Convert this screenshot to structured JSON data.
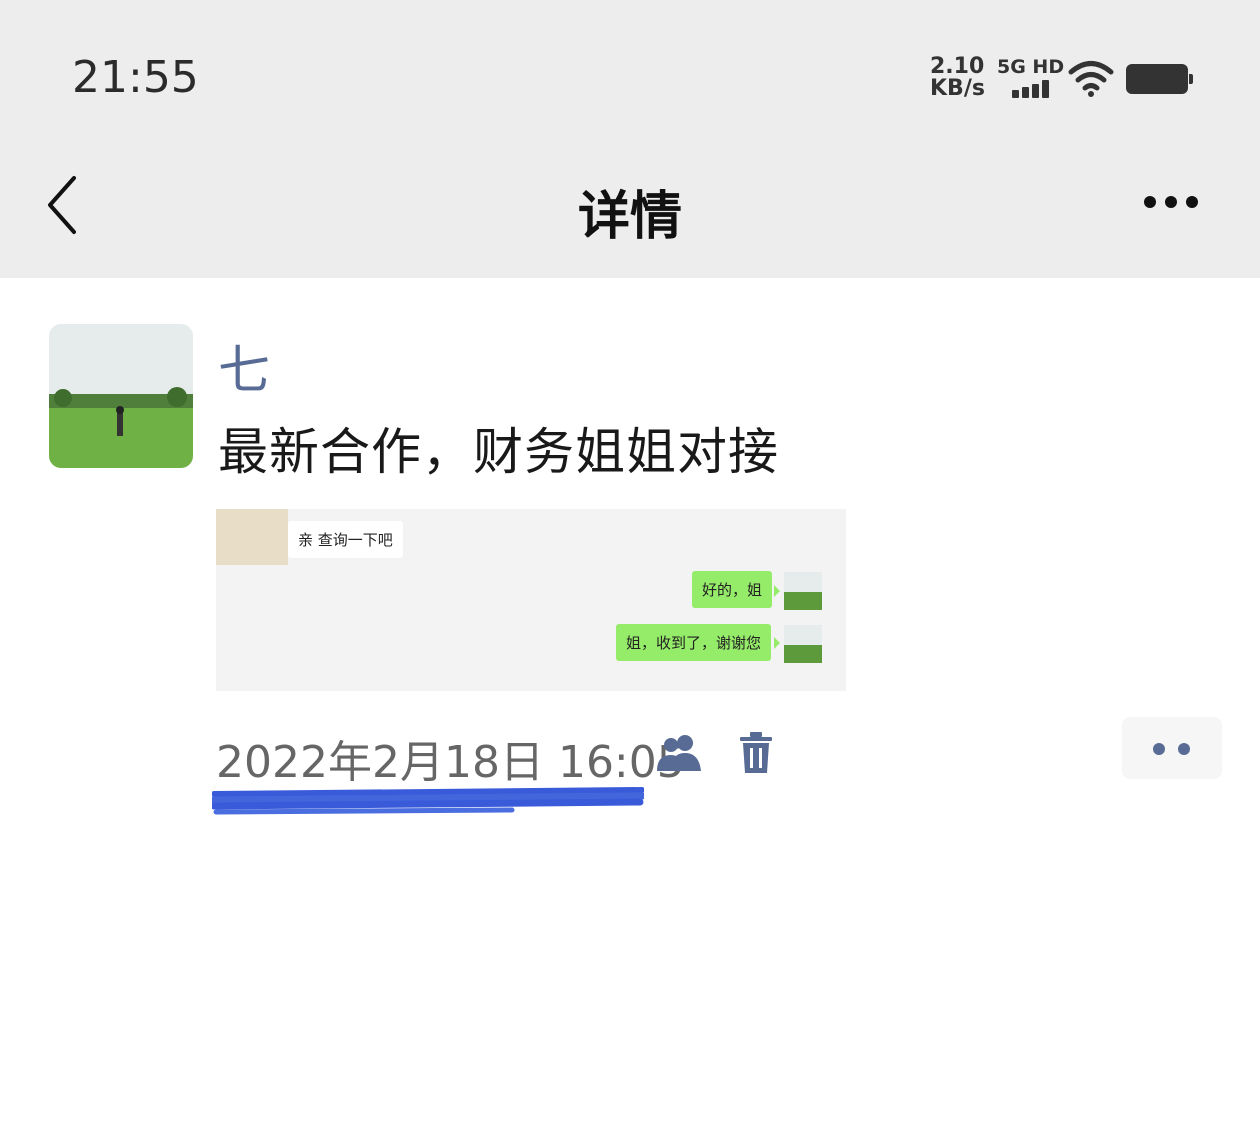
{
  "status_bar": {
    "time": "21:55",
    "net_speed_value": "2.10",
    "net_speed_unit": "KB/s",
    "network_type": "5G HD",
    "icons": [
      "signal-icon",
      "wifi-icon",
      "battery-icon"
    ]
  },
  "header": {
    "title": "详情",
    "back_icon": "chevron-left-icon",
    "more_icon": "more-icon"
  },
  "post": {
    "author": "七",
    "text": "最新合作，财务姐姐对接",
    "timestamp": "2022年2月18日 16:05",
    "icons": [
      "people-icon",
      "trash-icon",
      "comment-icon"
    ]
  },
  "screenshot": {
    "messages": [
      {
        "side": "left",
        "text": "亲 查询一下吧"
      },
      {
        "side": "right",
        "text": "好的，姐"
      },
      {
        "side": "right",
        "text": "姐，收到了，谢谢您"
      }
    ]
  },
  "colors": {
    "header_bg": "#ededed",
    "author_link": "#576b95",
    "bubble_green": "#95ec69",
    "scribble_blue": "#3a5bd9"
  }
}
